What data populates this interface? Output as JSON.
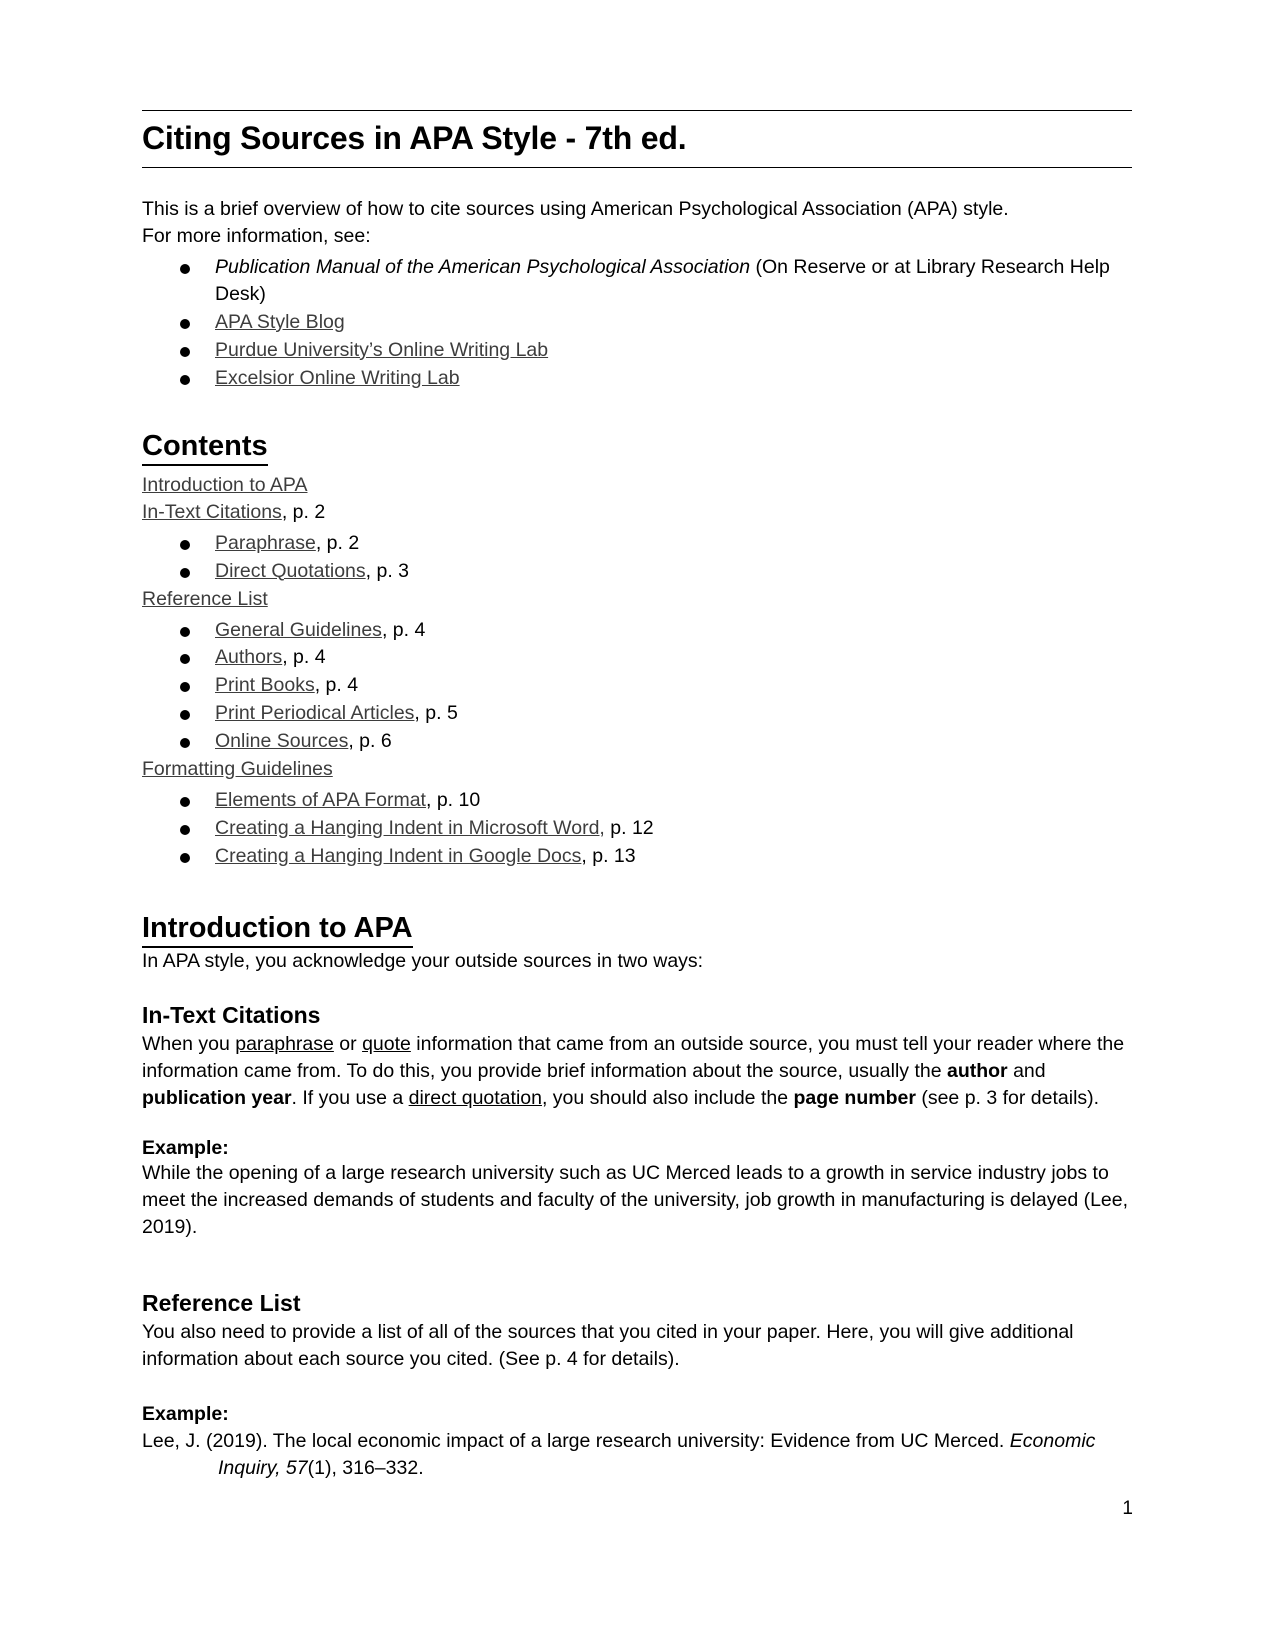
{
  "document": {
    "title": "Citing Sources in APA Style - 7th ed.",
    "page_number": "1"
  },
  "intro": {
    "line1": "This is a brief overview of how to cite sources using American Psychological Association (APA) style.",
    "line2": "For more information, see:",
    "resources": [
      {
        "italic_part": "Publication Manual of the American Psychological Association",
        "plain_part": " (On Reserve or at Library Research Help Desk)",
        "is_link": false
      },
      {
        "label": "APA Style Blog",
        "is_link": true
      },
      {
        "label": "Purdue University’s Online Writing Lab",
        "is_link": true
      },
      {
        "label": "Excelsior Online Writing Lab",
        "is_link": true
      }
    ]
  },
  "contents": {
    "heading": "Contents",
    "entries": [
      {
        "label": "Introduction to APA",
        "page": "",
        "level": "top"
      },
      {
        "label": "In-Text Citations",
        "page": ", p. 2",
        "level": "top"
      },
      {
        "label": "Paraphrase",
        "page": ", p. 2",
        "level": "sub"
      },
      {
        "label": "Direct Quotations",
        "page": ", p. 3",
        "level": "sub"
      },
      {
        "label": "Reference List",
        "page": "",
        "level": "top"
      },
      {
        "label": "General Guidelines",
        "page": ", p. 4",
        "level": "sub"
      },
      {
        "label": "Authors",
        "page": ", p. 4",
        "level": "sub"
      },
      {
        "label": "Print Books",
        "page": ", p. 4",
        "level": "sub"
      },
      {
        "label": "Print Periodical Articles",
        "page": ", p. 5",
        "level": "sub"
      },
      {
        "label": "Online Sources",
        "page": ", p. 6",
        "level": "sub"
      },
      {
        "label": "Formatting Guidelines",
        "page": "",
        "level": "top"
      },
      {
        "label": "Elements of APA Format",
        "page": ", p. 10",
        "level": "sub"
      },
      {
        "label": "Creating a Hanging Indent in Microsoft Word,",
        "page": " p. 12",
        "level": "sub"
      },
      {
        "label": "Creating a Hanging Indent in Google Docs",
        "page": ", p. 13",
        "level": "sub"
      }
    ]
  },
  "introduction_section": {
    "heading": "Introduction to APA",
    "body": "In APA style, you acknowledge your outside sources in two ways:"
  },
  "in_text_citations": {
    "heading": "In-Text Citations",
    "para_part1": "When you ",
    "link_paraphrase": "paraphrase",
    "para_part2": " or ",
    "link_quote": "quote",
    "para_part3": " information that came from an outside source, you must tell your reader where the information came from. To do this, you provide brief information about the source, usually the ",
    "bold_author": "author",
    "para_part4": " and ",
    "bold_pubyear": "publication year",
    "para_part5": ". If you use a ",
    "link_direct_quotation": "direct quotation",
    "para_part6": ", you should also include the ",
    "bold_pagenumber": "page number",
    "para_part7": " (see p. 3 for details).",
    "example_label": "Example:",
    "example_text": "While the opening of a large research university such as UC Merced leads to a growth in service industry jobs to meet the increased demands of students and faculty of the university, job growth in manufacturing is delayed (Lee, 2019)."
  },
  "reference_list": {
    "heading": "Reference List",
    "body": "You also need to provide a list of all of the sources that you cited in your paper. Here, you will give additional information about each source you cited. (See p. 4 for details).",
    "example_label": "Example:",
    "citation_part1": "Lee, J. (2019). The local economic impact of a large research university: Evidence from UC Merced. ",
    "citation_journal": "Economic Inquiry, 57",
    "citation_part2": "(1), 316–332."
  }
}
